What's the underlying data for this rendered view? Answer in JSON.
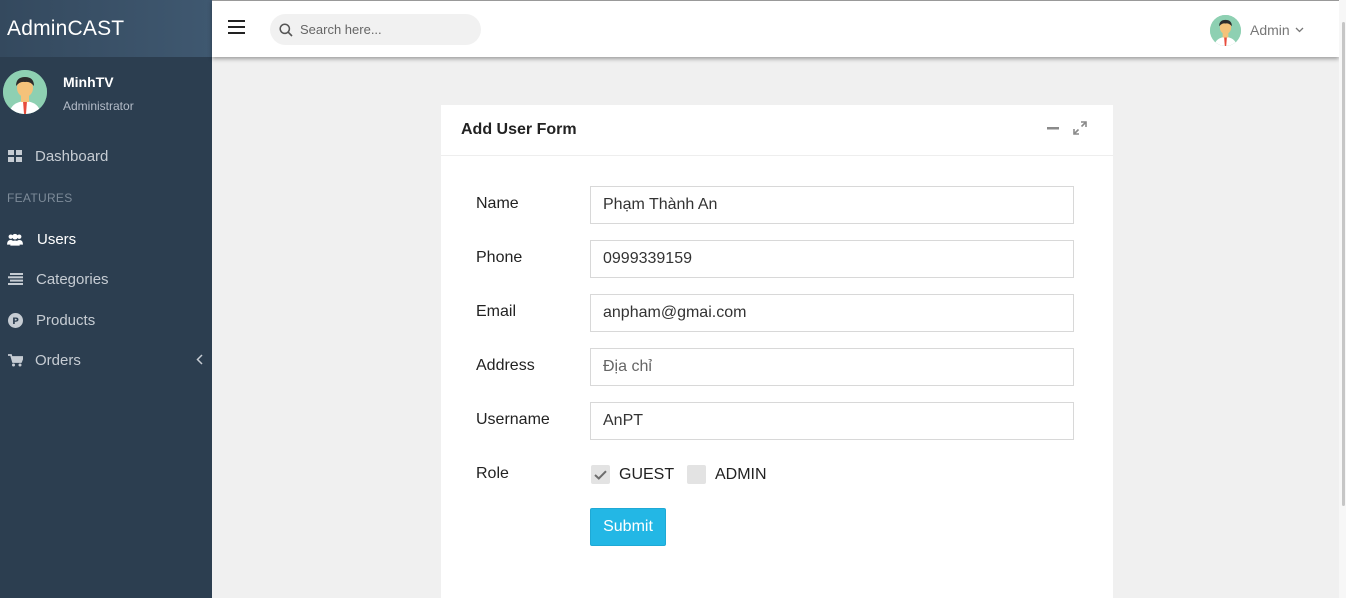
{
  "brand": {
    "title": "AdminCAST"
  },
  "sidebar": {
    "user": {
      "name": "MinhTV",
      "role": "Administrator"
    },
    "heading": "FEATURES",
    "items": [
      {
        "label": "Dashboard",
        "icon": "dashboard-icon"
      },
      {
        "label": "Users",
        "icon": "users-icon"
      },
      {
        "label": "Categories",
        "icon": "categories-icon"
      },
      {
        "label": "Products",
        "icon": "products-icon"
      },
      {
        "label": "Orders",
        "icon": "cart-icon"
      }
    ]
  },
  "header": {
    "search_placeholder": "Search here...",
    "account_label": "Admin"
  },
  "card": {
    "title": "Add User Form",
    "fields": [
      {
        "label": "Name",
        "value": "Phạm Thành An",
        "placeholder": ""
      },
      {
        "label": "Phone",
        "value": "0999339159",
        "placeholder": ""
      },
      {
        "label": "Email",
        "value": "anpham@gmai.com",
        "placeholder": ""
      },
      {
        "label": "Address",
        "value": "",
        "placeholder": "Địa chỉ"
      },
      {
        "label": "Username",
        "value": "AnPT",
        "placeholder": ""
      }
    ],
    "role_label": "Role",
    "roles": [
      {
        "label": "GUEST",
        "checked": true
      },
      {
        "label": "ADMIN",
        "checked": false
      }
    ],
    "submit_label": "Submit"
  },
  "colors": {
    "sidebar_bg": "#2c3e50",
    "accent": "#23b7e5",
    "page_bg": "#f0f0f0"
  }
}
